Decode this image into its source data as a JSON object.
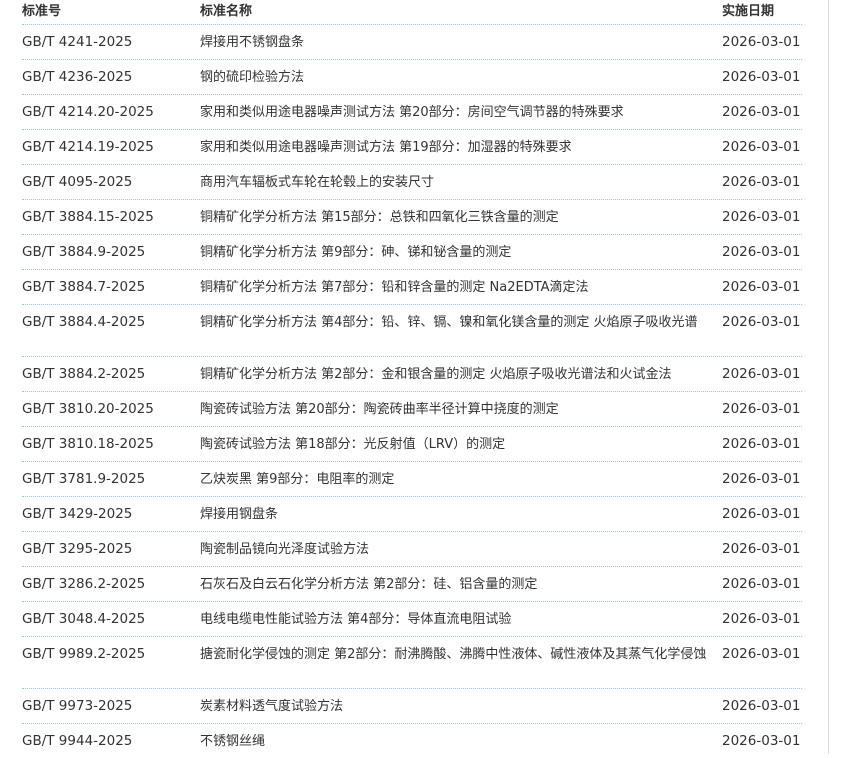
{
  "headers": {
    "number": "标准号",
    "name": "标准名称",
    "date": "实施日期"
  },
  "rows": [
    {
      "number": "GB/T 4241-2025",
      "name": "焊接用不锈钢盘条",
      "date": "2026-03-01"
    },
    {
      "number": "GB/T 4236-2025",
      "name": "钢的硫印检验方法",
      "date": "2026-03-01"
    },
    {
      "number": "GB/T 4214.20-2025",
      "name": "家用和类似用途电器噪声测试方法 第20部分：房间空气调节器的特殊要求",
      "date": "2026-03-01"
    },
    {
      "number": "GB/T 4214.19-2025",
      "name": "家用和类似用途电器噪声测试方法 第19部分：加湿器的特殊要求",
      "date": "2026-03-01"
    },
    {
      "number": "GB/T 4095-2025",
      "name": "商用汽车辐板式车轮在轮毂上的安装尺寸",
      "date": "2026-03-01"
    },
    {
      "number": "GB/T 3884.15-2025",
      "name": "铜精矿化学分析方法 第15部分：总铁和四氧化三铁含量的测定",
      "date": "2026-03-01"
    },
    {
      "number": "GB/T 3884.9-2025",
      "name": "铜精矿化学分析方法 第9部分：砷、锑和铋含量的测定",
      "date": "2026-03-01"
    },
    {
      "number": "GB/T 3884.7-2025",
      "name": "铜精矿化学分析方法 第7部分：铅和锌含量的测定 Na2EDTA滴定法",
      "date": "2026-03-01"
    },
    {
      "number": "GB/T 3884.4-2025",
      "name": "铜精矿化学分析方法 第4部分：铅、锌、镉、镍和氧化镁含量的测定 火焰原子吸收光谱",
      "date": "2026-03-01"
    },
    {
      "number": "GB/T 3884.2-2025",
      "name": "铜精矿化学分析方法 第2部分：金和银含量的测定 火焰原子吸收光谱法和火试金法",
      "date": "2026-03-01"
    },
    {
      "number": "GB/T 3810.20-2025",
      "name": "陶瓷砖试验方法 第20部分：陶瓷砖曲率半径计算中挠度的测定",
      "date": "2026-03-01"
    },
    {
      "number": "GB/T 3810.18-2025",
      "name": "陶瓷砖试验方法 第18部分：光反射值（LRV）的测定",
      "date": "2026-03-01"
    },
    {
      "number": "GB/T 3781.9-2025",
      "name": "乙炔炭黑 第9部分：电阻率的测定",
      "date": "2026-03-01"
    },
    {
      "number": "GB/T 3429-2025",
      "name": "焊接用钢盘条",
      "date": "2026-03-01"
    },
    {
      "number": "GB/T 3295-2025",
      "name": "陶瓷制品镜向光泽度试验方法",
      "date": "2026-03-01"
    },
    {
      "number": "GB/T 3286.2-2025",
      "name": "石灰石及白云石化学分析方法 第2部分：硅、铝含量的测定",
      "date": "2026-03-01"
    },
    {
      "number": "GB/T 3048.4-2025",
      "name": "电线电缆电性能试验方法 第4部分：导体直流电阻试验",
      "date": "2026-03-01"
    },
    {
      "number": "GB/T 9989.2-2025",
      "name": "搪瓷耐化学侵蚀的测定 第2部分：耐沸腾酸、沸腾中性液体、碱性液体及其蒸气化学侵蚀",
      "date": "2026-03-01"
    },
    {
      "number": "GB/T 9973-2025",
      "name": "炭素材料透气度试验方法",
      "date": "2026-03-01"
    },
    {
      "number": "GB/T 9944-2025",
      "name": "不锈钢丝绳",
      "date": "2026-03-01"
    }
  ]
}
